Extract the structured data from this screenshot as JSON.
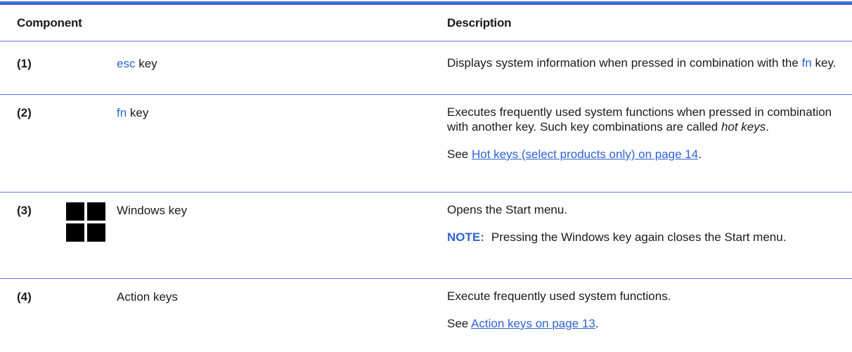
{
  "header": {
    "component": "Component",
    "description": "Description"
  },
  "rows": [
    {
      "num": "(1)",
      "key_name": "esc",
      "key_suffix": " key",
      "desc": {
        "text1": "Displays system information when pressed in combination with the ",
        "key": "fn",
        "text2": " key."
      }
    },
    {
      "num": "(2)",
      "key_name": "fn",
      "key_suffix": " key",
      "desc": {
        "text1": "Executes frequently used system functions when pressed in combination with another key. Such key combinations are called ",
        "italic": "hot keys",
        "text2": ".",
        "see_prefix": "See ",
        "see_link": "Hot keys (select products only) on page 14",
        "see_suffix": "."
      }
    },
    {
      "num": "(3)",
      "icon": "windows-logo-icon",
      "label": "Windows key",
      "desc": {
        "text1": "Opens the Start menu.",
        "note_label": "NOTE:",
        "note_text": "Pressing the Windows key again closes the Start menu."
      }
    },
    {
      "num": "(4)",
      "label": "Action keys",
      "desc": {
        "text1": "Execute frequently used system functions.",
        "see_prefix": "See ",
        "see_link": "Action keys on page 13",
        "see_suffix": "."
      }
    }
  ],
  "colors": {
    "accent": "#3d6ad6",
    "link": "#2f62d6",
    "text": "#1a1a1a"
  }
}
